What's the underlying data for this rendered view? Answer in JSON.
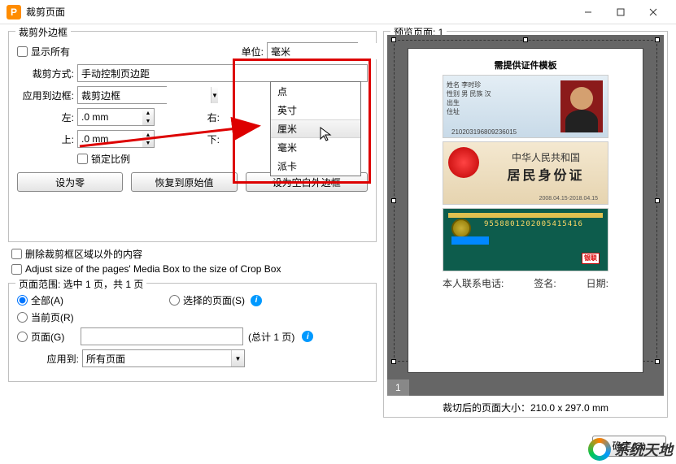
{
  "window": {
    "title": "裁剪页面"
  },
  "fieldset1": {
    "legend": "裁剪外边框",
    "showAll": "显示所有",
    "unitLabel": "单位:",
    "unitValue": "毫米",
    "unitOptions": [
      "点",
      "英寸",
      "厘米",
      "毫米",
      "派卡"
    ],
    "cropMethodLabel": "裁剪方式:",
    "cropMethodValue": "手动控制页边距",
    "applyToBorderLabel": "应用到边框:",
    "applyToBorderValue": "裁剪边框",
    "leftLabel": "左:",
    "leftValue": ".0 mm",
    "rightLabel": "右:",
    "topLabel": "上:",
    "topValue": ".0 mm",
    "bottomLabel": "下:",
    "lockRatio": "锁定比例",
    "setZero": "设为零",
    "resetDefault": "恢复到原始值",
    "setBlank": "设为空白外边框"
  },
  "options": {
    "removeOutside": "删除裁剪框区域以外的内容",
    "adjustMedia": "Adjust size of the pages' Media Box to the size of Crop Box"
  },
  "pageRange": {
    "legend": "页面范围: 选中 1 页，共 1 页",
    "all": "全部(A)",
    "selected": "选择的页面(S)",
    "current": "当前页(R)",
    "pages": "页面(G)",
    "totalPages": "(总计 1 页)",
    "applyToLabel": "应用到:",
    "applyToValue": "所有页面"
  },
  "preview": {
    "legend": "预览页面: 1",
    "pageNum": "1",
    "docTitle": "需提供证件模板",
    "idcard": {
      "line1": "中华人民共和国",
      "line2": "居民身份证"
    },
    "card1code": "210203196809236015",
    "card2date": "2008.04.15-2018.04.15",
    "card3num": "9558801202005415416",
    "unionpay": "银联",
    "footer": {
      "phone": "本人联系电话:",
      "sign": "签名:",
      "date": "日期:"
    },
    "cropSize": "裁切后的页面大小：210.0 x 297.0 mm"
  },
  "buttons": {
    "ok": "确定(O)"
  },
  "watermark": "系统天地"
}
